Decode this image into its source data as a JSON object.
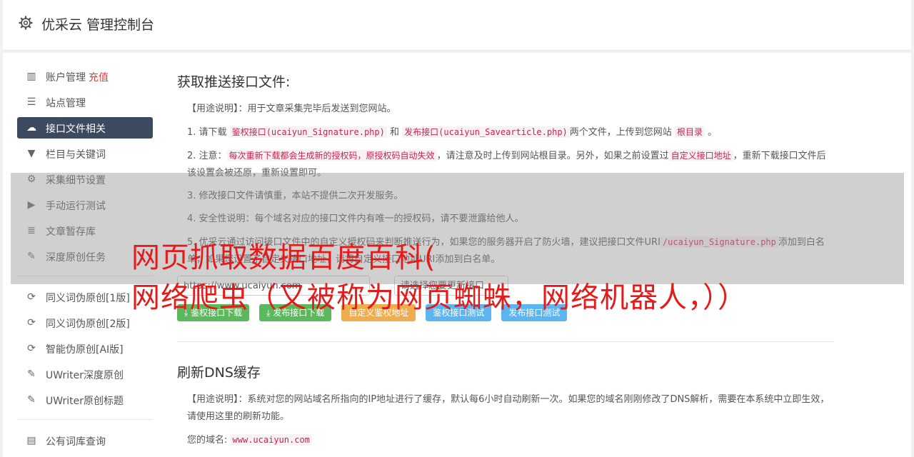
{
  "header": {
    "title": "优采云 管理控制台"
  },
  "sidebar": {
    "group1": [
      {
        "label": "账户管理",
        "extra": "充值",
        "icon": "bar-chart-icon",
        "glyph": "▥"
      },
      {
        "label": "站点管理",
        "icon": "server-icon",
        "glyph": "☰"
      },
      {
        "label": "接口文件相关",
        "icon": "cloud-upload-icon",
        "glyph": "☁",
        "active": true
      },
      {
        "label": "栏目与关键词",
        "icon": "filter-icon",
        "glyph": "▼"
      },
      {
        "label": "采集细节设置",
        "icon": "cogs-icon",
        "glyph": "⚙"
      },
      {
        "label": "手动运行测试",
        "icon": "play-circle-icon",
        "glyph": "▶"
      },
      {
        "label": "文章暂存库",
        "icon": "database-icon",
        "glyph": "≣"
      },
      {
        "label": "深度原创任务",
        "icon": "edit-icon",
        "glyph": "✎"
      }
    ],
    "group2": [
      {
        "label": "同义词伪原创[1版]",
        "icon": "refresh-icon",
        "glyph": "⟳"
      },
      {
        "label": "同义词伪原创[2版]",
        "icon": "refresh-icon",
        "glyph": "⟳"
      },
      {
        "label": "智能伪原创[AI版]",
        "icon": "refresh-icon",
        "glyph": "⟳"
      },
      {
        "label": "UWriter深度原创",
        "icon": "edit-icon",
        "glyph": "✎"
      },
      {
        "label": "UWriter原创标题",
        "icon": "edit-icon",
        "glyph": "✎"
      }
    ],
    "group3": [
      {
        "label": "公有词库查询",
        "icon": "book-icon",
        "glyph": "▤"
      }
    ]
  },
  "section1": {
    "title": "获取推送接口文件:",
    "usage": "【用途说明】：用于文章采集完毕后发送到您网站。",
    "s1_a": "1. 请下载",
    "s1_code1": "鉴权接口(ucaiyun_Signature.php)",
    "s1_b": "和",
    "s1_code2": "发布接口(ucaiyun_Savearticle.php)",
    "s1_c": "两个文件，上传到您网站",
    "s1_code3": "根目录",
    "s1_d": "。",
    "s2_a": "2. 注意：",
    "s2_code1": "每次重新下载都会生成新的授权码，原授权码自动失效",
    "s2_b": "，请注意及时上传到网站根目录。另外，如果之前设置过",
    "s2_code2": "自定义接口地址",
    "s2_c": "，重新下载接口文件后该设置会被还原，重新设置即可。",
    "s3": "3. 修改接口文件请慎重，本站不提供二次开发服务。",
    "s4": "4. 安全性说明：每个域名对应的接口文件内有唯一的授权码，请不要泄露给他人。",
    "s5_a": "5. 优采云通过访问接口文件中的自定义授权码来判断推送行为，如果您的服务器开启了防火墙，建议把接口文件URI",
    "s5_code": "/ucaiyun_Signature.php",
    "s5_b": "添加到白名单，如果您设置了自定义接口地址，请将自定义接口地址URI添加到白名单。",
    "input_domain": "https://www.ucaiyun.com",
    "input_select": "请选择您要更新接口",
    "buttons": [
      "鉴权接口下载",
      "发布接口下载",
      "自定义鉴权地址",
      "鉴权接口测试",
      "发布接口测试"
    ]
  },
  "section2": {
    "title": "刷新DNS缓存",
    "usage": "【用途说明】：系统对您的网站域名所指向的IP地址进行了缓存，默认每6小时自动刷新一次。如果您的域名刚刚修改了DNS解析，需要在本系统中立即生效，请使用这里的刷新功能。",
    "domain_label": "您的域名:",
    "domain_value": "www.ucaiyun.com"
  },
  "overlay": {
    "line1": "网页抓取数据百度百科(",
    "line2": "网络爬虫（又被称为网页蜘蛛，网络机器人，））"
  }
}
